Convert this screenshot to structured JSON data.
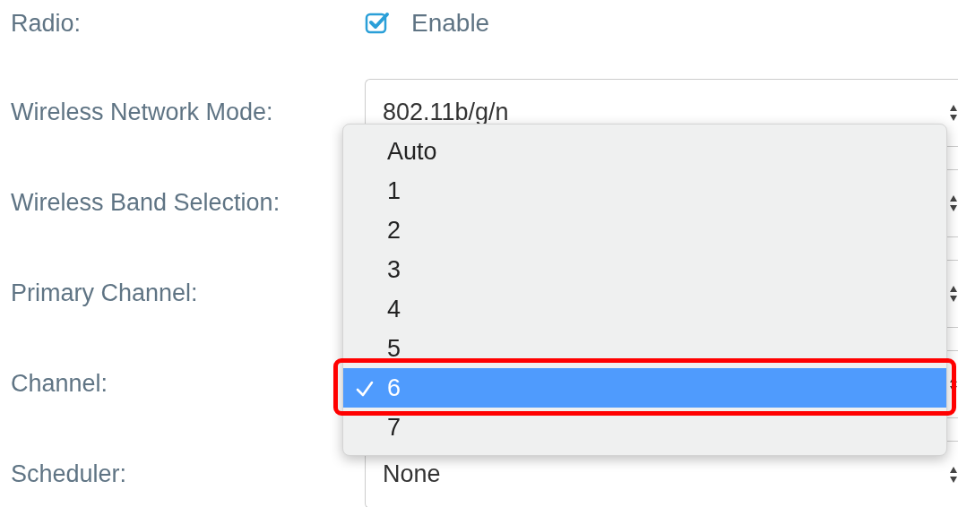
{
  "fields": [
    {
      "label": "Radio:",
      "kind": "checkbox",
      "checked": true,
      "option": "Enable"
    },
    {
      "label": "Wireless Network Mode:",
      "kind": "select",
      "value": "802.11b/g/n"
    },
    {
      "label": "Wireless Band Selection:",
      "kind": "select"
    },
    {
      "label": "Primary Channel:",
      "kind": "select"
    },
    {
      "label": "Channel:",
      "kind": "select"
    },
    {
      "label": "Scheduler:",
      "kind": "select",
      "value": "None"
    }
  ],
  "channel_dropdown": {
    "options": [
      {
        "label": "Auto",
        "selected": false
      },
      {
        "label": "1",
        "selected": false
      },
      {
        "label": "2",
        "selected": false
      },
      {
        "label": "3",
        "selected": false
      },
      {
        "label": "4",
        "selected": false
      },
      {
        "label": "5",
        "selected": false
      },
      {
        "label": "6",
        "selected": true
      },
      {
        "label": "7",
        "selected": false
      }
    ]
  }
}
